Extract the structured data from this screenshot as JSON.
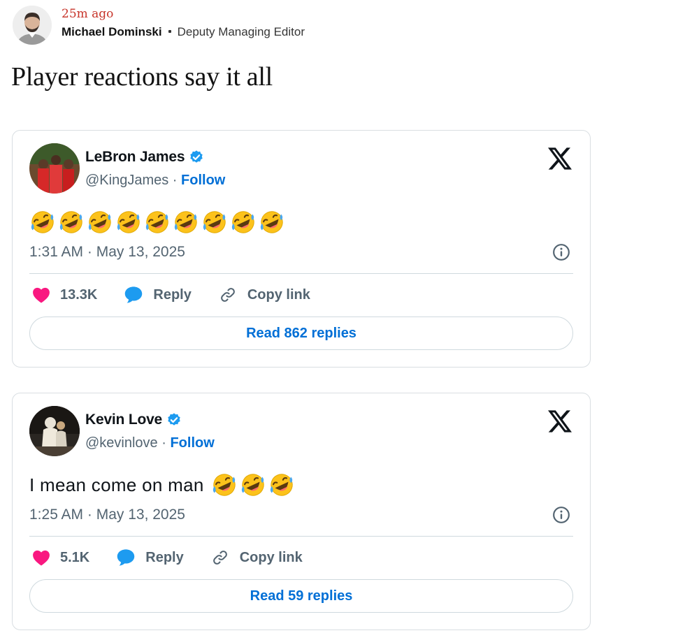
{
  "byline": {
    "time_ago": "25m ago",
    "author": "Michael Dominski",
    "role": "Deputy Managing Editor"
  },
  "headline": "Player reactions say it all",
  "tweets": [
    {
      "name": "LeBron James",
      "handle": "@KingJames",
      "separator": " · ",
      "follow": "Follow",
      "text": "",
      "emoji": [
        "rolling-on-floor-laughing-emoji",
        "rolling-on-floor-laughing-emoji",
        "rolling-on-floor-laughing-emoji",
        "rolling-on-floor-laughing-emoji",
        "rolling-on-floor-laughing-emoji",
        "rolling-on-floor-laughing-emoji",
        "rolling-on-floor-laughing-emoji",
        "rolling-on-floor-laughing-emoji",
        "rolling-on-floor-laughing-emoji"
      ],
      "timestamp": "1:31 AM · May 13, 2025",
      "likes": "13.3K",
      "reply_label": "Reply",
      "copy_label": "Copy link",
      "read_replies": "Read 862 replies"
    },
    {
      "name": "Kevin Love",
      "handle": "@kevinlove",
      "separator": " · ",
      "follow": "Follow",
      "text": "I mean come on man",
      "emoji": [
        "rolling-on-floor-laughing-emoji",
        "rolling-on-floor-laughing-emoji",
        "rolling-on-floor-laughing-emoji"
      ],
      "timestamp": "1:25 AM · May 13, 2025",
      "likes": "5.1K",
      "reply_label": "Reply",
      "copy_label": "Copy link",
      "read_replies": "Read 59 replies"
    }
  ],
  "colors": {
    "accent_blue": "#006fd6",
    "like_pink": "#f91880",
    "byline_time_red": "#c7352b",
    "verified_blue": "#1d9bf0",
    "emoji_yellow": "#fcc21b"
  }
}
